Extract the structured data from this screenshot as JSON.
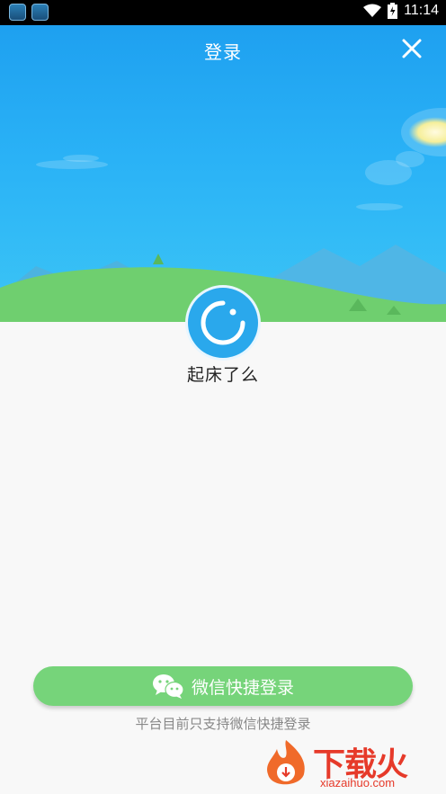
{
  "status_bar": {
    "time": "11:14"
  },
  "header": {
    "title": "登录"
  },
  "app": {
    "name": "起床了么"
  },
  "login": {
    "wechat_button_label": "微信快捷登录",
    "note": "平台目前只支持微信快捷登录"
  },
  "watermark": {
    "brand": "下载火",
    "url": "xiazaihuo.com"
  },
  "colors": {
    "sky_top": "#1ea0f0",
    "sky_bottom": "#3cc5f5",
    "hill_green": "#6fcf6f",
    "button_green": "#76d47a",
    "logo_blue": "#2aa8ec",
    "watermark_red": "#e63a2a"
  },
  "icons": {
    "close": "close-icon",
    "wechat": "wechat-icon",
    "wifi": "wifi-icon",
    "battery": "battery-icon",
    "logo": "app-logo-icon"
  }
}
